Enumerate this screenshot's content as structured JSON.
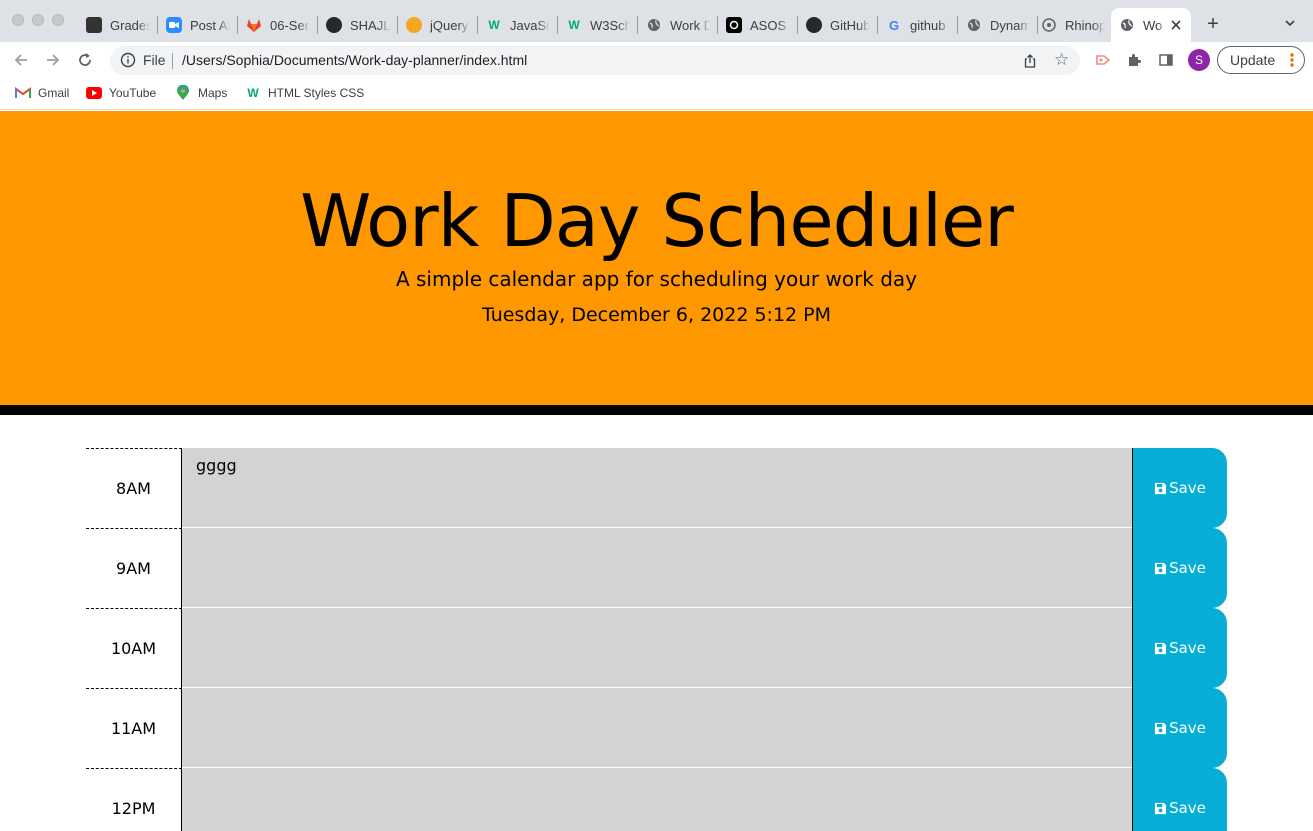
{
  "browser": {
    "tabs": [
      {
        "label": "Grades",
        "icon": "grades-favicon",
        "color": "#333333"
      },
      {
        "label": "Post At",
        "icon": "zoom-favicon",
        "color": "#2d8cff"
      },
      {
        "label": "06-Ser",
        "icon": "gitlab-favicon",
        "color": "#e24329"
      },
      {
        "label": "SHAJL",
        "icon": "github-favicon",
        "color": "#24292e"
      },
      {
        "label": "jQuery",
        "icon": "jquery-favicon",
        "color": "#f5a623"
      },
      {
        "label": "JavaSc",
        "icon": "w3schools-favicon",
        "color": "#04aa6d"
      },
      {
        "label": "W3Sch",
        "icon": "w3schools-favicon",
        "color": "#04aa6d"
      },
      {
        "label": "Work D",
        "icon": "globe-favicon",
        "color": "#5f6368"
      },
      {
        "label": "ASOS",
        "icon": "asos-favicon",
        "color": "#000000"
      },
      {
        "label": "GitHub",
        "icon": "github-favicon",
        "color": "#24292e"
      },
      {
        "label": "github",
        "icon": "google-favicon",
        "color": "#4285f4"
      },
      {
        "label": "Dynam",
        "icon": "globe-favicon",
        "color": "#5f6368"
      },
      {
        "label": "Rhinop",
        "icon": "rhino-favicon",
        "color": "#5f6368"
      },
      {
        "label": "Wo",
        "icon": "globe-favicon",
        "color": "#5f6368"
      }
    ],
    "url_scheme": "File",
    "url": "/Users/Sophia/Documents/Work-day-planner/index.html",
    "profile_initial": "S",
    "update_label": "Update",
    "bookmarks": [
      {
        "label": "Gmail",
        "icon": "gmail-icon"
      },
      {
        "label": "YouTube",
        "icon": "youtube-icon"
      },
      {
        "label": "Maps",
        "icon": "maps-icon"
      },
      {
        "label": "HTML Styles CSS",
        "icon": "w3schools-icon"
      }
    ]
  },
  "header": {
    "title": "Work Day Scheduler",
    "lead": "A simple calendar app for scheduling your work day",
    "current_day": "Tuesday, December 6, 2022 5:12 PM"
  },
  "schedule": {
    "save_label": "Save",
    "rows": [
      {
        "hour": "8AM",
        "text": "gggg"
      },
      {
        "hour": "9AM",
        "text": ""
      },
      {
        "hour": "10AM",
        "text": ""
      },
      {
        "hour": "11AM",
        "text": ""
      },
      {
        "hour": "12PM",
        "text": ""
      }
    ]
  },
  "colors": {
    "jumbotron": "#ff9800",
    "save_button": "#06aed5",
    "past_row": "#d3d3d3"
  }
}
